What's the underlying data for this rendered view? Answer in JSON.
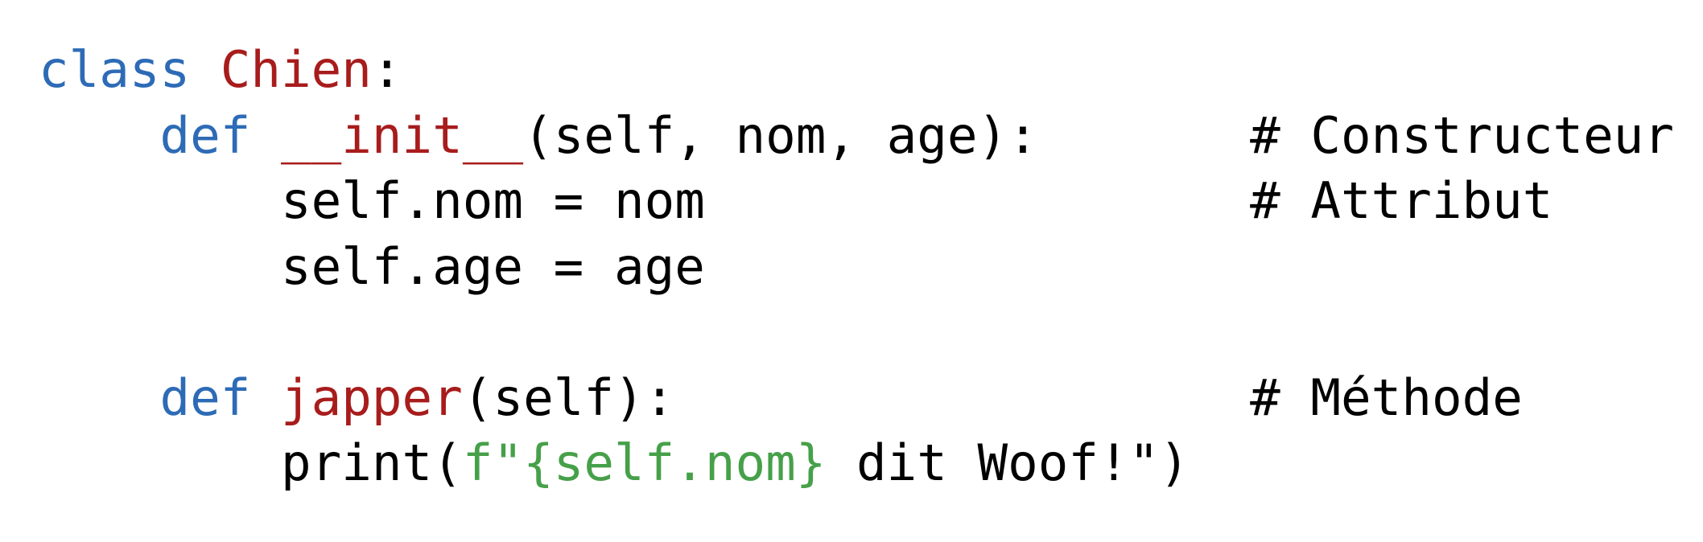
{
  "code": {
    "language": "Python",
    "colors": {
      "keyword": "#2d6bb6",
      "name": "#a81c1c",
      "fstring": "#46a049",
      "plain": "#000000"
    },
    "lines": [
      {
        "indent": "",
        "tokens": [
          {
            "t": "class",
            "c": "keyword"
          },
          {
            "t": " ",
            "c": "plain"
          },
          {
            "t": "Chien",
            "c": "name"
          },
          {
            "t": ":",
            "c": "plain"
          }
        ],
        "comment": ""
      },
      {
        "indent": "    ",
        "tokens": [
          {
            "t": "def",
            "c": "keyword"
          },
          {
            "t": " ",
            "c": "plain"
          },
          {
            "t": "__init__",
            "c": "name"
          },
          {
            "t": "(self, nom, age):",
            "c": "plain"
          }
        ],
        "comment": "# Constructeur"
      },
      {
        "indent": "        ",
        "tokens": [
          {
            "t": "self.nom = nom",
            "c": "plain"
          }
        ],
        "comment": "# Attribut"
      },
      {
        "indent": "        ",
        "tokens": [
          {
            "t": "self.age = age",
            "c": "plain"
          }
        ],
        "comment": ""
      },
      {
        "indent": "",
        "tokens": [],
        "comment": ""
      },
      {
        "indent": "    ",
        "tokens": [
          {
            "t": "def",
            "c": "keyword"
          },
          {
            "t": " ",
            "c": "plain"
          },
          {
            "t": "japper",
            "c": "name"
          },
          {
            "t": "(self):",
            "c": "plain"
          }
        ],
        "comment": "# Méthode"
      },
      {
        "indent": "        ",
        "tokens": [
          {
            "t": "print(",
            "c": "plain"
          },
          {
            "t": "f\"{self.nom}",
            "c": "fstring"
          },
          {
            "t": " dit Woof!\")",
            "c": "plain"
          }
        ],
        "comment": ""
      }
    ]
  }
}
